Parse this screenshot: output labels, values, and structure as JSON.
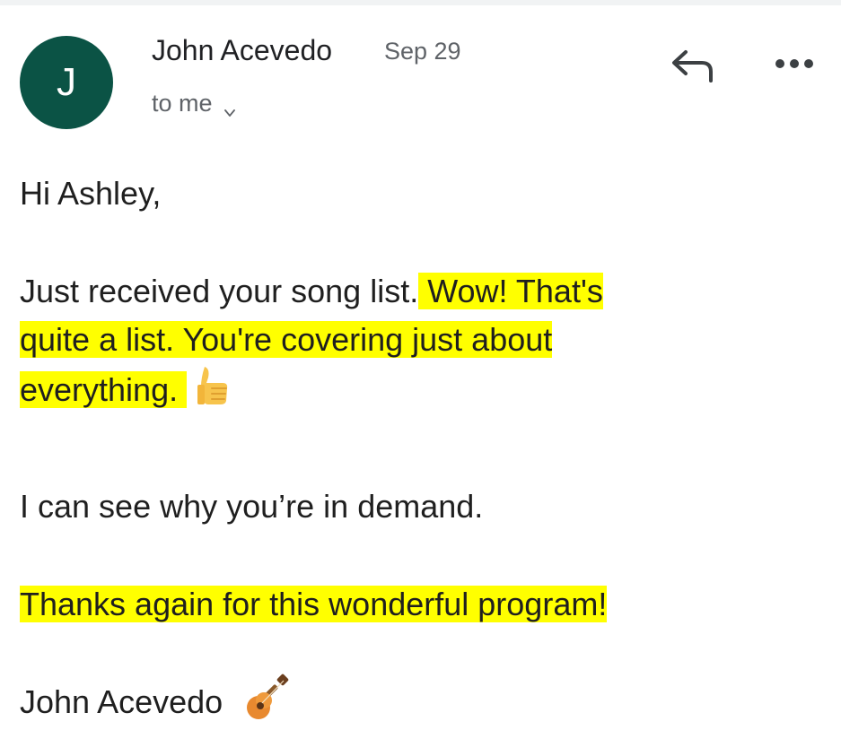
{
  "message": {
    "sender_initial": "J",
    "sender_name": "John Acevedo",
    "date": "Sep 29",
    "recipients": "to me",
    "icons": {
      "reply": "reply-icon",
      "more": "more-options-icon",
      "expand": "chevron-down-icon",
      "thumb": "thumbs-up-emoji",
      "guitar": "guitar-emoji"
    },
    "colors": {
      "avatar": "#0b5345",
      "highlight": "#ffff00"
    }
  },
  "body": {
    "greeting": "Hi Ashley,",
    "p1_plain": "Just received your song list.",
    "p1_hl_a": " Wow! That's",
    "p1_hl_b": "quite a list.  You're covering just about",
    "p1_hl_c": "everything. ",
    "p2": "I can see why you’re in demand.",
    "p3": "Thanks again for this wonderful program!",
    "signature": "John Acevedo"
  }
}
